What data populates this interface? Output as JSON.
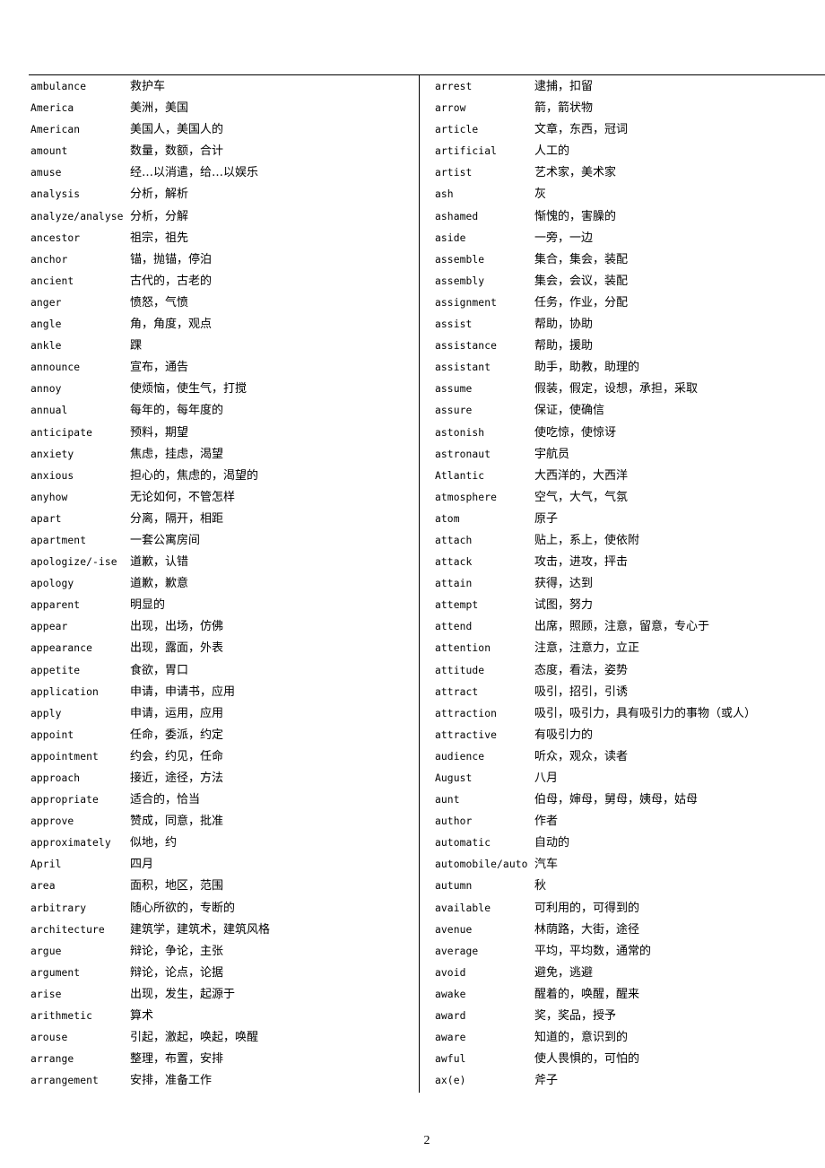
{
  "document": {
    "page_number": "2",
    "left_column": [
      {
        "word": "ambulance",
        "meaning": "救护车"
      },
      {
        "word": "America",
        "meaning": "美洲，美国"
      },
      {
        "word": "American",
        "meaning": "美国人，美国人的"
      },
      {
        "word": "amount",
        "meaning": "数量，数额，合计"
      },
      {
        "word": "amuse",
        "meaning": "经…以消遣，给…以娱乐"
      },
      {
        "word": "analysis",
        "meaning": "分析，解析"
      },
      {
        "word": "analyze/analyse",
        "meaning": "分析，分解"
      },
      {
        "word": "ancestor",
        "meaning": "祖宗，祖先"
      },
      {
        "word": "anchor",
        "meaning": "锚，抛锚，停泊"
      },
      {
        "word": "ancient",
        "meaning": "古代的，古老的"
      },
      {
        "word": "anger",
        "meaning": "愤怒，气愤"
      },
      {
        "word": "angle",
        "meaning": "角，角度，观点"
      },
      {
        "word": "ankle",
        "meaning": "踝"
      },
      {
        "word": "announce",
        "meaning": "宣布，通告"
      },
      {
        "word": "annoy",
        "meaning": "使烦恼，使生气，打搅"
      },
      {
        "word": "annual",
        "meaning": "每年的，每年度的"
      },
      {
        "word": "anticipate",
        "meaning": "预料，期望"
      },
      {
        "word": "anxiety",
        "meaning": "焦虑，挂虑，渴望"
      },
      {
        "word": "anxious",
        "meaning": "担心的，焦虑的，渴望的"
      },
      {
        "word": "anyhow",
        "meaning": "无论如何，不管怎样"
      },
      {
        "word": "apart",
        "meaning": "分离，隔开，相距"
      },
      {
        "word": "apartment",
        "meaning": "一套公寓房间"
      },
      {
        "word": "apologize/-ise",
        "meaning": "道歉，认错"
      },
      {
        "word": "apology",
        "meaning": "道歉，歉意"
      },
      {
        "word": "apparent",
        "meaning": "明显的"
      },
      {
        "word": "appear",
        "meaning": "出现，出场，仿佛"
      },
      {
        "word": "appearance",
        "meaning": "出现，露面，外表"
      },
      {
        "word": "appetite",
        "meaning": "食欲，胃口"
      },
      {
        "word": "application",
        "meaning": "申请，申请书，应用"
      },
      {
        "word": "apply",
        "meaning": "申请，运用，应用"
      },
      {
        "word": "appoint",
        "meaning": "任命，委派，约定"
      },
      {
        "word": "appointment",
        "meaning": "约会，约见，任命"
      },
      {
        "word": "approach",
        "meaning": "接近，途径，方法"
      },
      {
        "word": "appropriate",
        "meaning": "适合的，恰当"
      },
      {
        "word": "approve",
        "meaning": "赞成，同意，批准"
      },
      {
        "word": "approximately",
        "meaning": "似地，约"
      },
      {
        "word": "April",
        "meaning": "四月"
      },
      {
        "word": "area",
        "meaning": "面积，地区，范围"
      },
      {
        "word": "arbitrary",
        "meaning": "随心所欲的，专断的"
      },
      {
        "word": "architecture",
        "meaning": "建筑学，建筑术，建筑风格"
      },
      {
        "word": "argue",
        "meaning": "辩论，争论，主张"
      },
      {
        "word": "argument",
        "meaning": "辩论，论点，论据"
      },
      {
        "word": "arise",
        "meaning": "出现，发生，起源于"
      },
      {
        "word": "arithmetic",
        "meaning": "算术"
      },
      {
        "word": "arouse",
        "meaning": "引起，激起，唤起，唤醒"
      },
      {
        "word": "arrange",
        "meaning": "整理，布置，安排"
      },
      {
        "word": "arrangement",
        "meaning": "安排，准备工作"
      }
    ],
    "right_column": [
      {
        "word": "arrest",
        "meaning": "逮捕，扣留"
      },
      {
        "word": "arrow",
        "meaning": "箭，箭状物"
      },
      {
        "word": "article",
        "meaning": "文章，东西，冠词"
      },
      {
        "word": "artificial",
        "meaning": "人工的"
      },
      {
        "word": "artist",
        "meaning": "艺术家，美术家"
      },
      {
        "word": "ash",
        "meaning": "灰"
      },
      {
        "word": "ashamed",
        "meaning": "惭愧的，害臊的"
      },
      {
        "word": "aside",
        "meaning": "一旁，一边"
      },
      {
        "word": "assemble",
        "meaning": "集合，集会，装配"
      },
      {
        "word": "assembly",
        "meaning": "集会，会议，装配"
      },
      {
        "word": "assignment",
        "meaning": "任务，作业，分配"
      },
      {
        "word": "assist",
        "meaning": "帮助，协助"
      },
      {
        "word": "assistance",
        "meaning": "帮助，援助"
      },
      {
        "word": "assistant",
        "meaning": "助手，助教，助理的"
      },
      {
        "word": "assume",
        "meaning": "假装，假定，设想，承担，采取"
      },
      {
        "word": "assure",
        "meaning": "保证，使确信"
      },
      {
        "word": "astonish",
        "meaning": "使吃惊，使惊讶"
      },
      {
        "word": "astronaut",
        "meaning": "宇航员"
      },
      {
        "word": "Atlantic",
        "meaning": "大西洋的，大西洋"
      },
      {
        "word": "atmosphere",
        "meaning": "空气，大气，气氛"
      },
      {
        "word": "atom",
        "meaning": "原子"
      },
      {
        "word": "attach",
        "meaning": "贴上，系上，使依附"
      },
      {
        "word": "attack",
        "meaning": "攻击，进攻，抨击"
      },
      {
        "word": "attain",
        "meaning": "获得，达到"
      },
      {
        "word": "attempt",
        "meaning": "试图，努力"
      },
      {
        "word": "attend",
        "meaning": "出席，照顾，注意，留意，专心于"
      },
      {
        "word": "attention",
        "meaning": "注意，注意力，立正"
      },
      {
        "word": "attitude",
        "meaning": "态度，看法，姿势"
      },
      {
        "word": "attract",
        "meaning": "吸引，招引，引诱"
      },
      {
        "word": "attraction",
        "meaning": "吸引，吸引力，具有吸引力的事物（或人）"
      },
      {
        "word": "attractive",
        "meaning": "有吸引力的"
      },
      {
        "word": "audience",
        "meaning": "听众，观众，读者"
      },
      {
        "word": "August",
        "meaning": "八月"
      },
      {
        "word": "aunt",
        "meaning": "伯母，婶母，舅母，姨母，姑母"
      },
      {
        "word": "author",
        "meaning": "作者"
      },
      {
        "word": "automatic",
        "meaning": "自动的"
      },
      {
        "word": "automobile/auto",
        "meaning": "汽车"
      },
      {
        "word": "autumn",
        "meaning": "秋"
      },
      {
        "word": "available",
        "meaning": "可利用的，可得到的"
      },
      {
        "word": "avenue",
        "meaning": "林荫路，大街，途径"
      },
      {
        "word": "average",
        "meaning": "平均，平均数，通常的"
      },
      {
        "word": "avoid",
        "meaning": "避免，逃避"
      },
      {
        "word": "awake",
        "meaning": "醒着的，唤醒，醒来"
      },
      {
        "word": "award",
        "meaning": "奖，奖品，授予"
      },
      {
        "word": "aware",
        "meaning": "知道的，意识到的"
      },
      {
        "word": "awful",
        "meaning": "使人畏惧的，可怕的"
      },
      {
        "word": "ax(e)",
        "meaning": "斧子"
      }
    ]
  }
}
